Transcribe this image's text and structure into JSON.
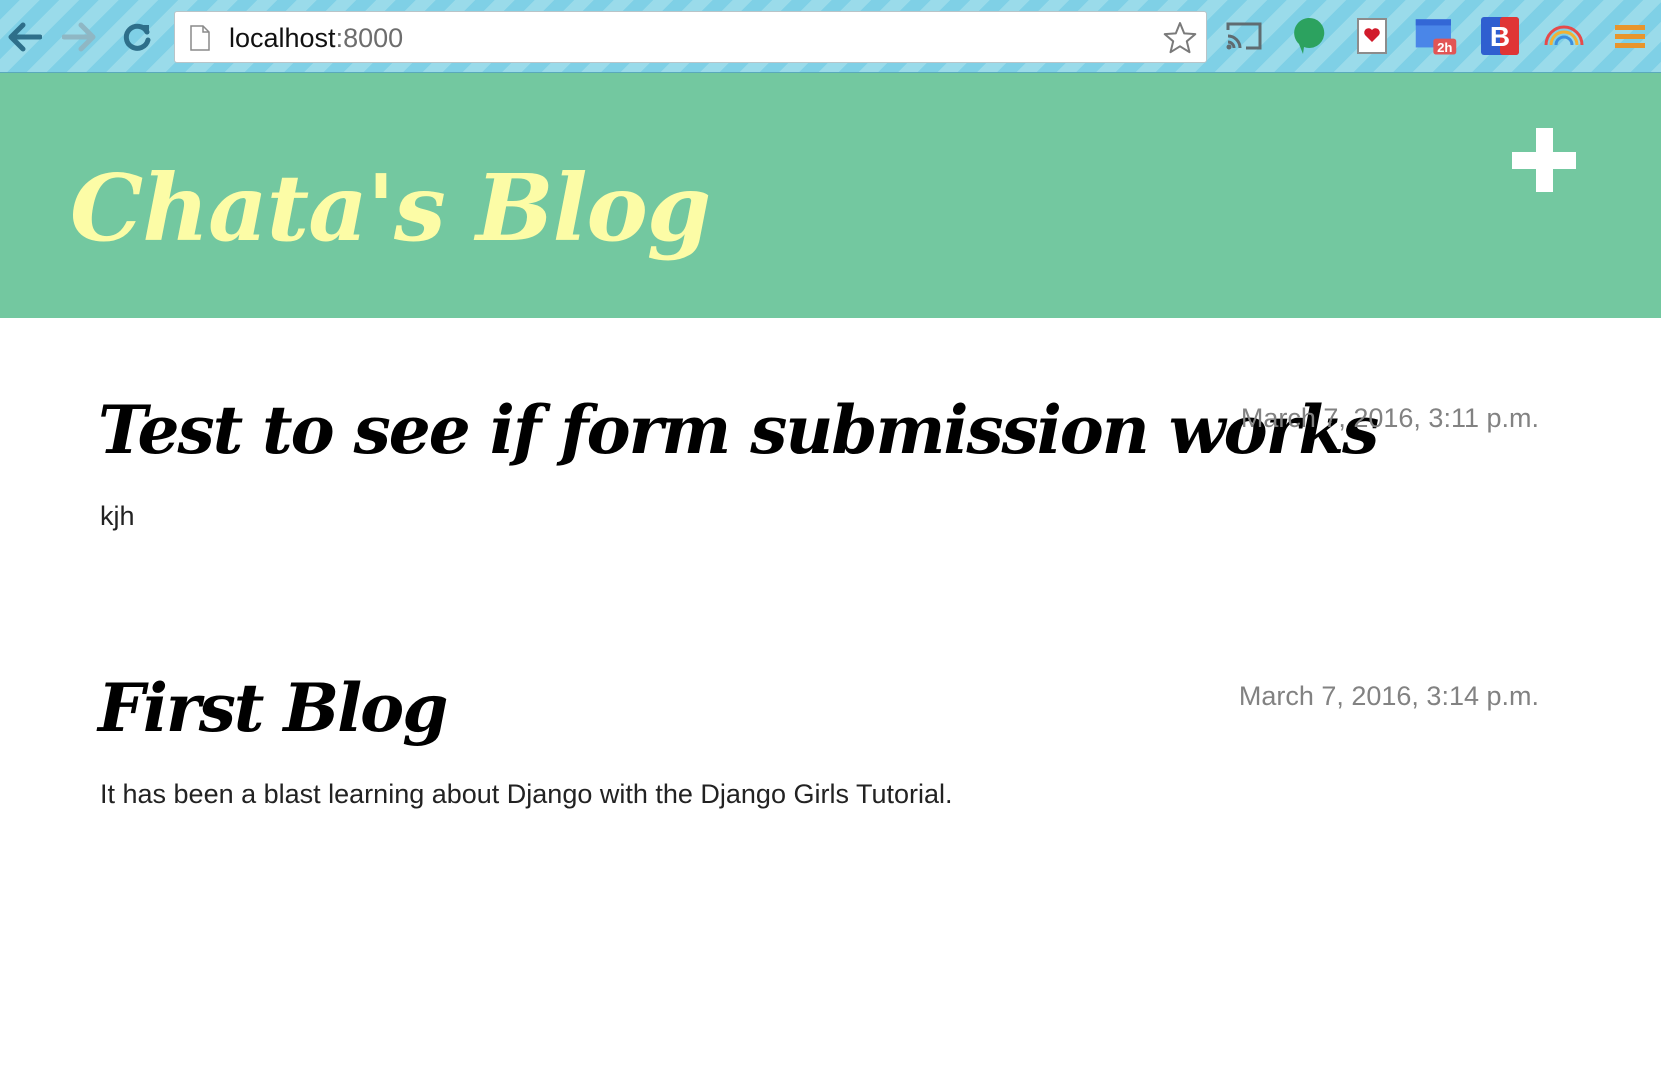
{
  "browser": {
    "url_host": "localhost",
    "url_port": ":8000",
    "extensions": [
      "cast-icon",
      "chat-bubble-icon",
      "heart-card-icon",
      "calendar-2h-icon",
      "b-badge-icon",
      "rainbow-arc-icon",
      "menu-icon"
    ],
    "calendar_badge": "2h",
    "b_badge_label": "B"
  },
  "header": {
    "title": "Chata's Blog",
    "add_icon": "plus-icon",
    "background_color": "#73c8a0",
    "title_color": "#fcfca6"
  },
  "posts": [
    {
      "title": "Test to see if form submission works",
      "date": "March 7, 2016, 3:11 p.m.",
      "text": "kjh"
    },
    {
      "title": "First Blog",
      "date": "March 7, 2016, 3:14 p.m.",
      "text": "It has been a blast learning about Django with the Django Girls Tutorial."
    }
  ]
}
